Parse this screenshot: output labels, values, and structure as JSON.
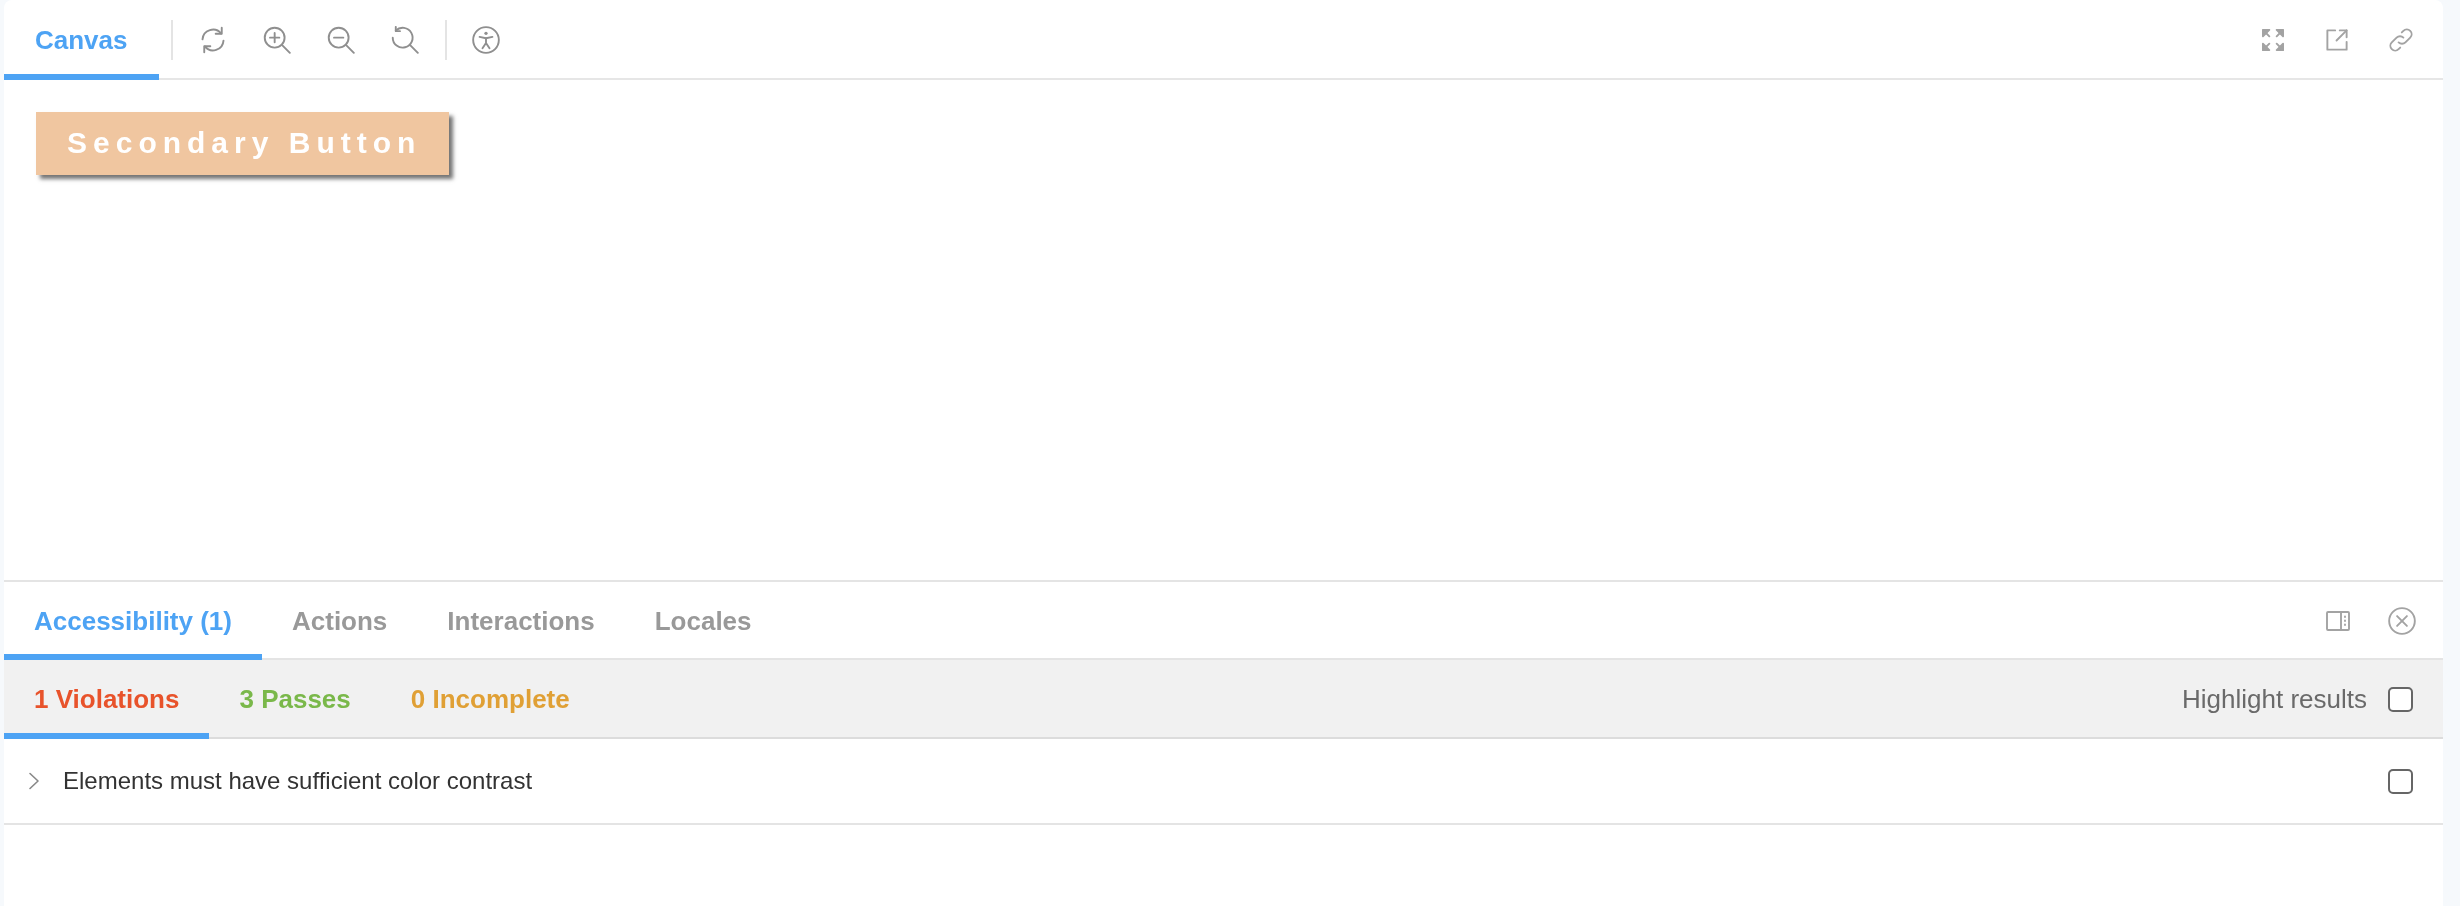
{
  "toolbar": {
    "tabs": [
      {
        "label": "Canvas",
        "selected": true
      }
    ]
  },
  "canvas": {
    "button": {
      "label": "Secondary Button"
    }
  },
  "addons": {
    "tabs": [
      {
        "label": "Accessibility (1)",
        "selected": true
      },
      {
        "label": "Actions",
        "selected": false
      },
      {
        "label": "Interactions",
        "selected": false
      },
      {
        "label": "Locales",
        "selected": false
      }
    ],
    "result_tabs": [
      {
        "label": "1 Violations",
        "selected": true,
        "color": "#e8532b"
      },
      {
        "label": "3 Passes",
        "selected": false,
        "color": "#7ab84a"
      },
      {
        "label": "0 Incomplete",
        "selected": false,
        "color": "#e0a035"
      }
    ],
    "highlight": {
      "label": "Highlight results",
      "checked": false
    },
    "results": [
      {
        "title": "Elements must have sufficient color contrast",
        "expanded": false,
        "checked": false
      }
    ]
  }
}
